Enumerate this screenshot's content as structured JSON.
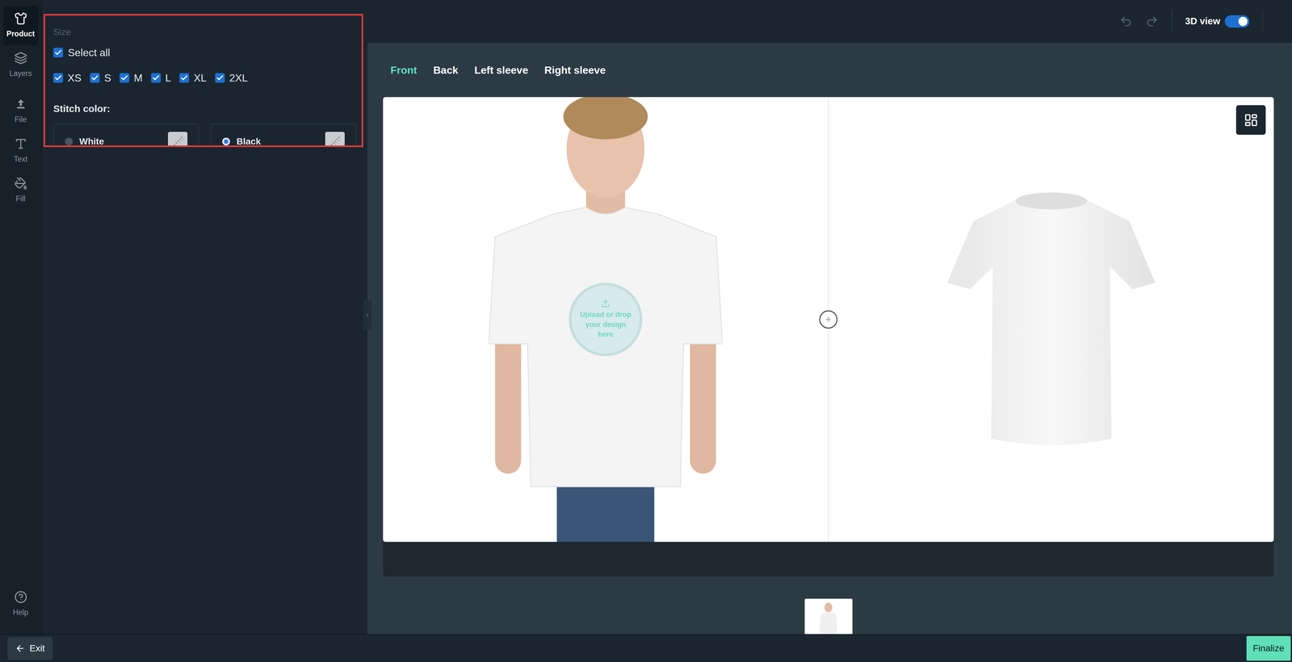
{
  "rail": [
    {
      "label": "Product",
      "selected": true
    },
    {
      "label": "Layers",
      "selected": false
    },
    {
      "label": "File",
      "selected": false
    },
    {
      "label": "Text",
      "selected": false
    },
    {
      "label": "Fill",
      "selected": false
    }
  ],
  "help": "Help",
  "size": {
    "title": "Size",
    "select_all": {
      "label": "Select all",
      "checked": true
    },
    "options": [
      {
        "label": "XS",
        "checked": true
      },
      {
        "label": "S",
        "checked": true
      },
      {
        "label": "M",
        "checked": true
      },
      {
        "label": "L",
        "checked": true
      },
      {
        "label": "XL",
        "checked": true
      },
      {
        "label": "2XL",
        "checked": true
      }
    ]
  },
  "stitch": {
    "title": "Stitch color:",
    "options": [
      {
        "label": "White",
        "selected": false
      },
      {
        "label": "Black",
        "selected": true
      }
    ]
  },
  "toolbar": {
    "view_3d": {
      "label": "3D view",
      "on": true
    }
  },
  "tabs": [
    {
      "label": "Front",
      "selected": true
    },
    {
      "label": "Back",
      "selected": false
    },
    {
      "label": "Left sleeve",
      "selected": false
    },
    {
      "label": "Right sleeve",
      "selected": false
    }
  ],
  "canvas": {
    "upload_hint": "Upload or drop your design here"
  },
  "buttons": {
    "exit": "Exit",
    "finalize": "Finalize"
  }
}
